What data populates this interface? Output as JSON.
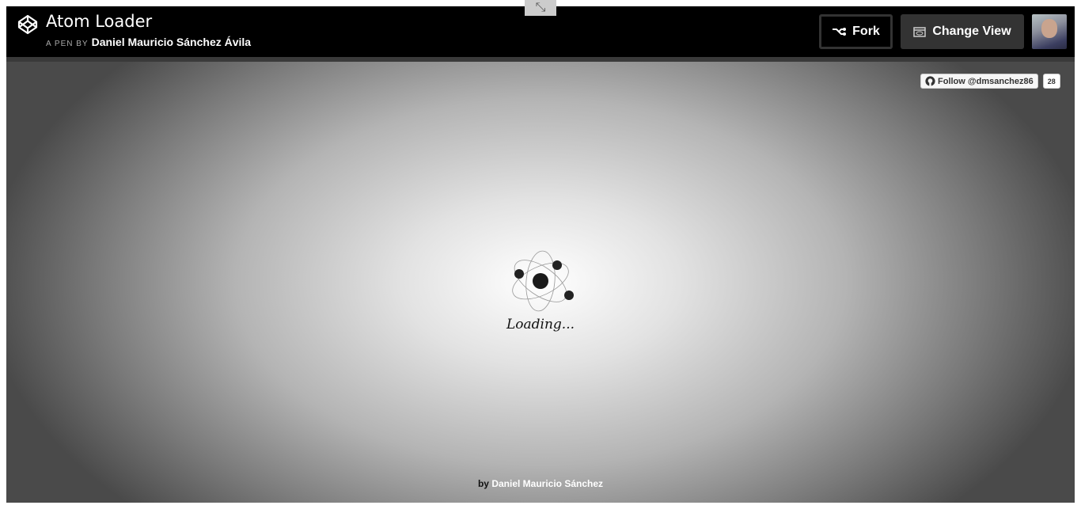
{
  "header": {
    "title": "Atom Loader",
    "byline_prefix": "A PEN BY",
    "author": "Daniel Mauricio Sánchez Ávila",
    "fork_label": "Fork",
    "change_view_label": "Change View"
  },
  "preview": {
    "github_follow_label": "Follow @dmsanchez86",
    "github_follow_count": "28",
    "loading_text": "Loading...",
    "credit_prefix": "by",
    "credit_name": "Daniel Mauricio Sánchez"
  }
}
